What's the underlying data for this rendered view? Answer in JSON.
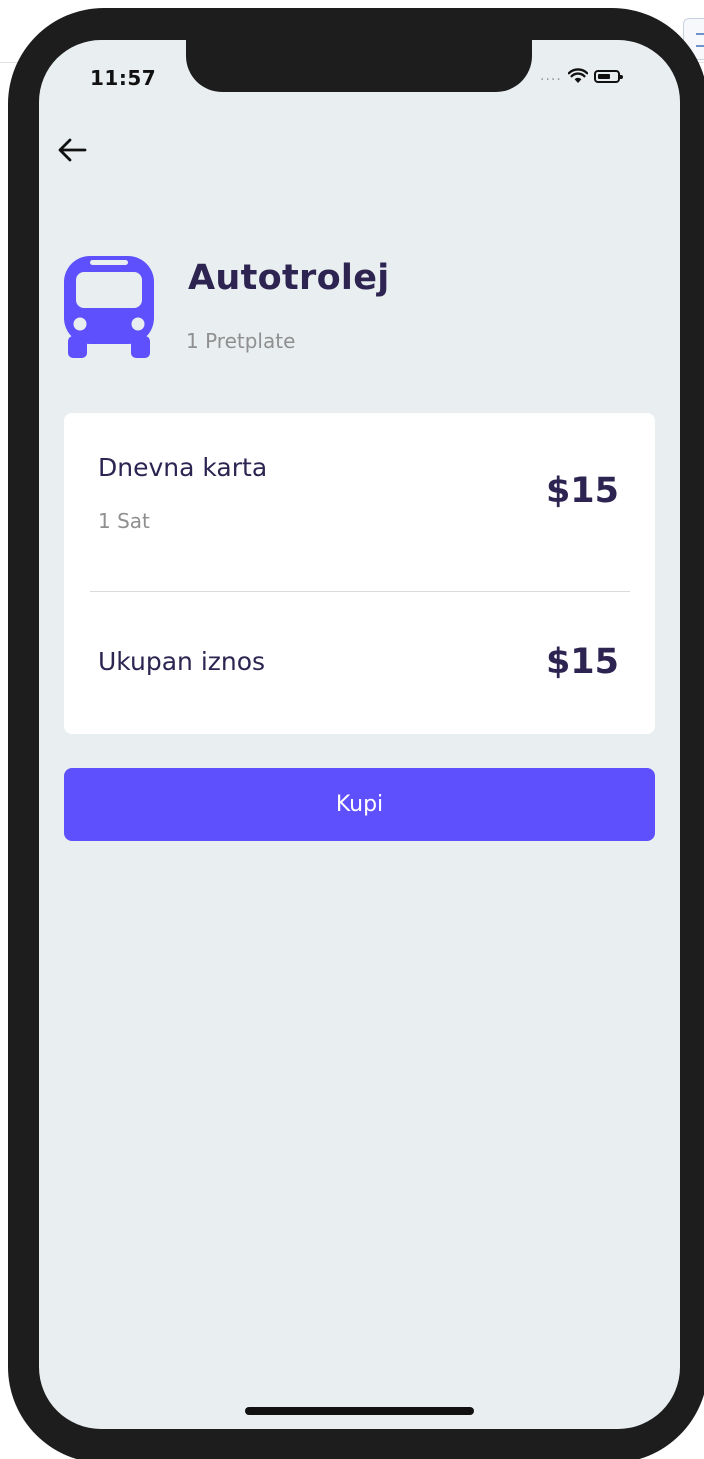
{
  "status_bar": {
    "time": "11:57",
    "signal": "....",
    "icons": [
      "wifi-icon",
      "battery-icon"
    ]
  },
  "navigation": {
    "back_icon": "arrow-left-icon"
  },
  "provider": {
    "icon": "bus-icon",
    "name": "Autotrolej",
    "subscriptions": "1 Pretplate"
  },
  "ticket": {
    "name": "Dnevna karta",
    "duration": "1 Sat",
    "price": "$15"
  },
  "total": {
    "label": "Ukupan iznos",
    "price": "$15"
  },
  "actions": {
    "buy_label": "Kupi"
  },
  "colors": {
    "accent": "#5f50fe",
    "text_dark": "#2d2452",
    "text_muted": "#8f8f8f",
    "screen_bg": "#e9eff0",
    "card_bg": "#ffffff",
    "frame": "#1d1d1d"
  }
}
